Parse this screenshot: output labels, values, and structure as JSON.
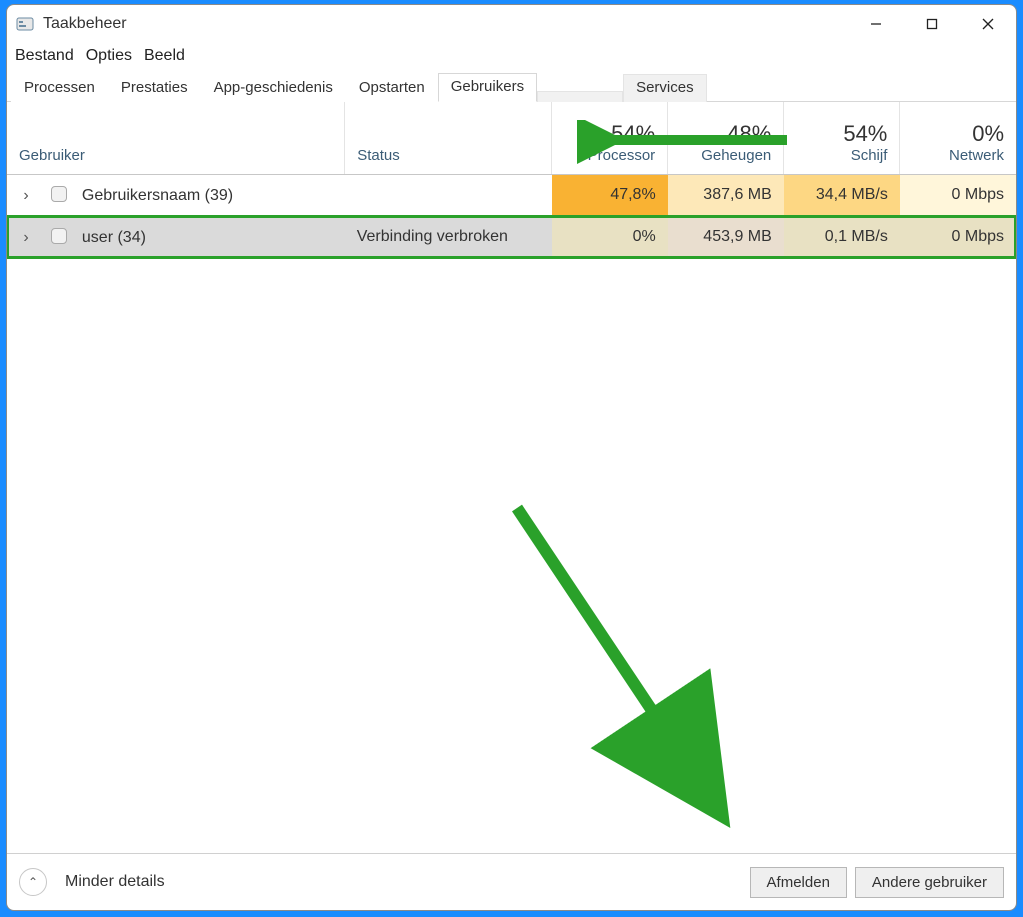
{
  "window": {
    "title": "Taakbeheer"
  },
  "menu": {
    "file": "Bestand",
    "options": "Opties",
    "view": "Beeld"
  },
  "tabs": {
    "processes": "Processen",
    "performance": "Prestaties",
    "apphistory": "App-geschiedenis",
    "startup": "Opstarten",
    "users": "Gebruikers",
    "services": "Services"
  },
  "columns": {
    "user": "Gebruiker",
    "status": "Status",
    "cpu": {
      "pct": "54%",
      "label": "Processor"
    },
    "mem": {
      "pct": "48%",
      "label": "Geheugen"
    },
    "disk": {
      "pct": "54%",
      "label": "Schijf"
    },
    "net": {
      "pct": "0%",
      "label": "Netwerk"
    }
  },
  "rows": [
    {
      "name": "Gebruikersnaam (39)",
      "status": "",
      "cpu": "47,8%",
      "mem": "387,6 MB",
      "disk": "34,4 MB/s",
      "net": "0 Mbps"
    },
    {
      "name": "user (34)",
      "status": "Verbinding verbroken",
      "cpu": "0%",
      "mem": "453,9 MB",
      "disk": "0,1 MB/s",
      "net": "0 Mbps"
    }
  ],
  "footer": {
    "fewer": "Minder details",
    "logoff": "Afmelden",
    "switch": "Andere gebruiker"
  }
}
